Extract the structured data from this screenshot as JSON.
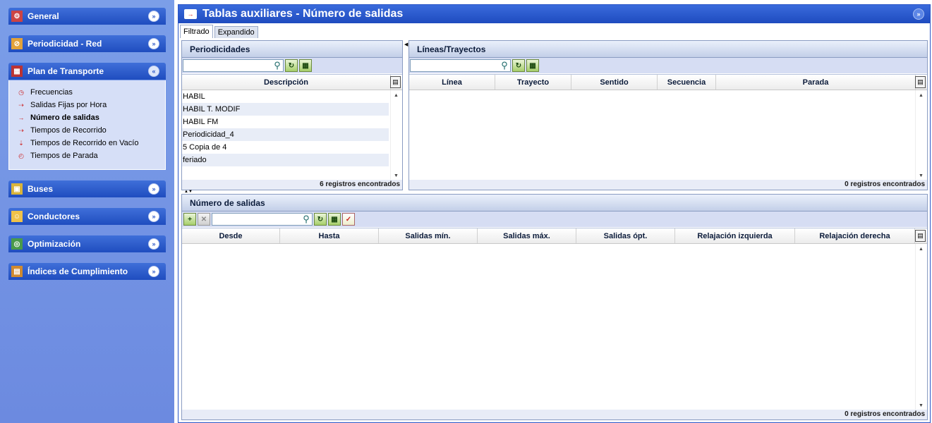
{
  "sidebar": {
    "groups": [
      {
        "label": "General",
        "chevron": "»"
      },
      {
        "label": "Periodicidad - Red",
        "chevron": "»"
      },
      {
        "label": "Plan de Transporte",
        "chevron": "«"
      },
      {
        "label": "Buses",
        "chevron": "»"
      },
      {
        "label": "Conductores",
        "chevron": "»"
      },
      {
        "label": "Optimización",
        "chevron": "»"
      },
      {
        "label": "Índices de Cumplimiento",
        "chevron": "»"
      }
    ],
    "plan_items": [
      {
        "label": "Frecuencias"
      },
      {
        "label": "Salidas Fijas por Hora"
      },
      {
        "label": "Número de salidas"
      },
      {
        "label": "Tiempos de Recorrido"
      },
      {
        "label": "Tiempos de Recorrido en Vacío"
      },
      {
        "label": "Tiempos de Parada"
      }
    ]
  },
  "window": {
    "title": "Tablas auxiliares - Número de salidas"
  },
  "tabs": [
    {
      "label": "Filtrado"
    },
    {
      "label": "Expandido"
    }
  ],
  "periodicidades": {
    "title": "Periodicidades",
    "column": "Descripción",
    "rows": [
      "HABIL",
      "HABIL T. MODIF",
      "HABIL FM",
      "Periodicidad_4",
      "5 Copia de 4",
      "feriado"
    ],
    "footer": "6 registros encontrados"
  },
  "lineas": {
    "title": "Líneas/Trayectos",
    "columns": [
      "Línea",
      "Trayecto",
      "Sentido",
      "Secuencia",
      "Parada"
    ],
    "footer": "0 registros encontrados"
  },
  "salidas": {
    "title": "Número de salidas",
    "columns": [
      "Desde",
      "Hasta",
      "Salidas mín.",
      "Salidas máx.",
      "Salidas ópt.",
      "Relajación izquierda",
      "Relajación derecha"
    ],
    "footer": "0 registros encontrados"
  },
  "colors": {
    "accent": "#1e4bbf",
    "sidebar": "#6c8ae0",
    "panel_header": "#c3cfe8"
  }
}
